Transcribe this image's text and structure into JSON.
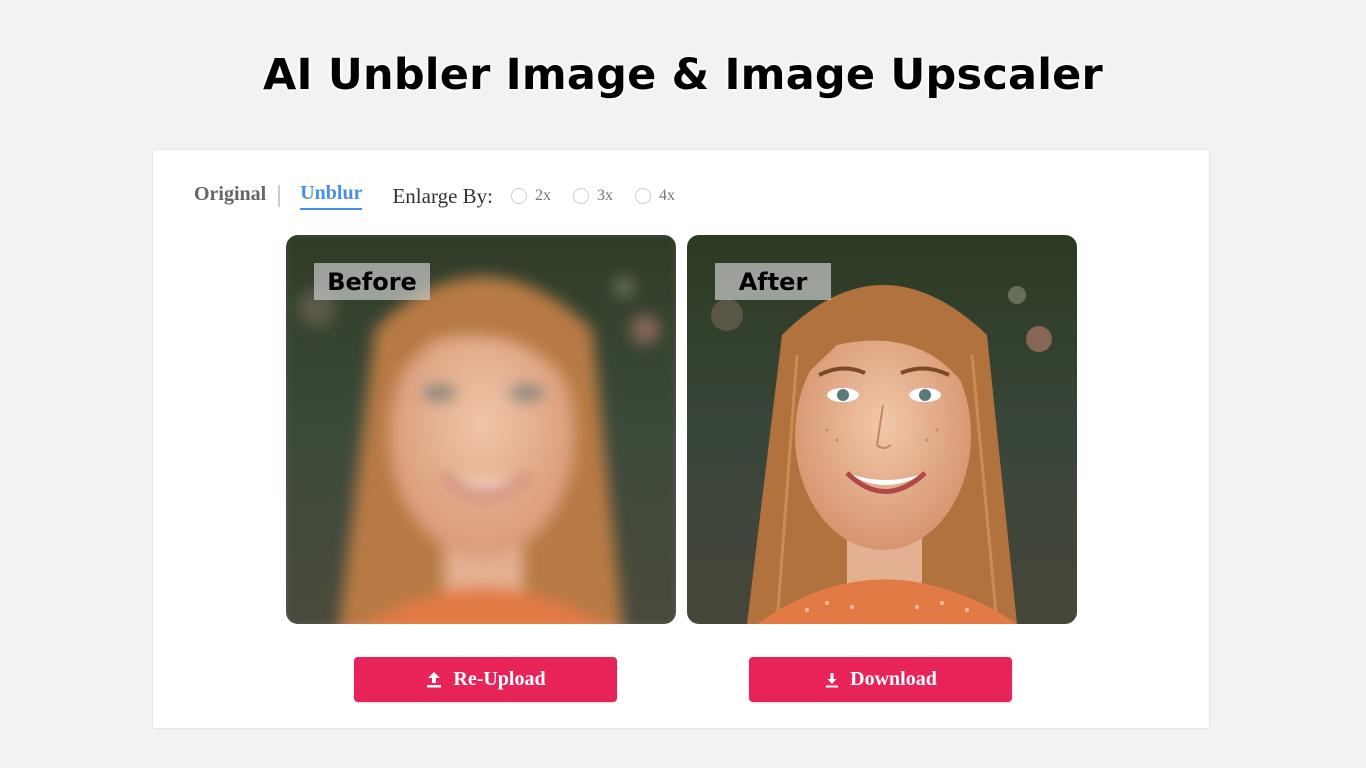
{
  "title": "AI Unbler Image & Image Upscaler",
  "tabs": [
    {
      "label": "Original",
      "active": false
    },
    {
      "label": "Unblur",
      "active": true
    }
  ],
  "enlarge": {
    "label": "Enlarge By:",
    "options": [
      "2x",
      "3x",
      "4x"
    ],
    "selected": null
  },
  "panels": {
    "before_label": "Before",
    "after_label": "After"
  },
  "buttons": {
    "reupload_label": "Re-Upload",
    "reupload_icon": "upload-icon",
    "download_label": "Download",
    "download_icon": "download-icon"
  },
  "colors": {
    "accent": "#e8235a",
    "active_tab": "#4a90e2",
    "background": "#f2f2f2"
  }
}
